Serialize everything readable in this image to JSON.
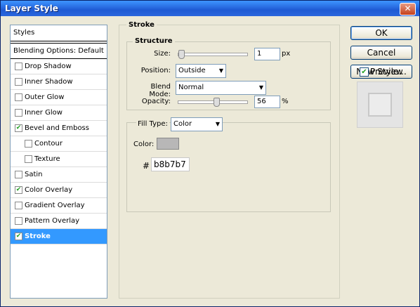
{
  "window": {
    "title": "Layer Style",
    "close_glyph": "✕"
  },
  "styles_panel": {
    "header": "Styles",
    "blending_options": "Blending Options: Default",
    "items": [
      {
        "label": "Drop Shadow",
        "checked": false,
        "indent": false,
        "selected": false
      },
      {
        "label": "Inner Shadow",
        "checked": false,
        "indent": false,
        "selected": false
      },
      {
        "label": "Outer Glow",
        "checked": false,
        "indent": false,
        "selected": false
      },
      {
        "label": "Inner Glow",
        "checked": false,
        "indent": false,
        "selected": false
      },
      {
        "label": "Bevel and Emboss",
        "checked": true,
        "indent": false,
        "selected": false
      },
      {
        "label": "Contour",
        "checked": false,
        "indent": true,
        "selected": false
      },
      {
        "label": "Texture",
        "checked": false,
        "indent": true,
        "selected": false
      },
      {
        "label": "Satin",
        "checked": false,
        "indent": false,
        "selected": false
      },
      {
        "label": "Color Overlay",
        "checked": true,
        "indent": false,
        "selected": false
      },
      {
        "label": "Gradient Overlay",
        "checked": false,
        "indent": false,
        "selected": false
      },
      {
        "label": "Pattern Overlay",
        "checked": false,
        "indent": false,
        "selected": false
      },
      {
        "label": "Stroke",
        "checked": true,
        "indent": false,
        "selected": true
      }
    ]
  },
  "stroke": {
    "title": "Stroke",
    "structure": {
      "title": "Structure",
      "size_label": "Size:",
      "size_value": "1",
      "size_unit": "px",
      "size_slider_fraction": 0.0,
      "position_label": "Position:",
      "position_value": "Outside",
      "blend_mode_label": "Blend Mode:",
      "blend_mode_value": "Normal",
      "opacity_label": "Opacity:",
      "opacity_value": "56",
      "opacity_unit": "%",
      "opacity_slider_fraction": 0.56
    },
    "fill": {
      "fill_type_label": "Fill Type:",
      "fill_type_value": "Color",
      "color_label": "Color:",
      "hash": "#",
      "hex_value": "b8b7b7",
      "swatch_color": "#b8b7b7"
    }
  },
  "buttons": {
    "ok": "OK",
    "cancel": "Cancel",
    "new_style": "New Style..."
  },
  "preview": {
    "label": "Preview",
    "checked": true
  },
  "check_glyph": "✔",
  "dropdown_glyph": "▼"
}
